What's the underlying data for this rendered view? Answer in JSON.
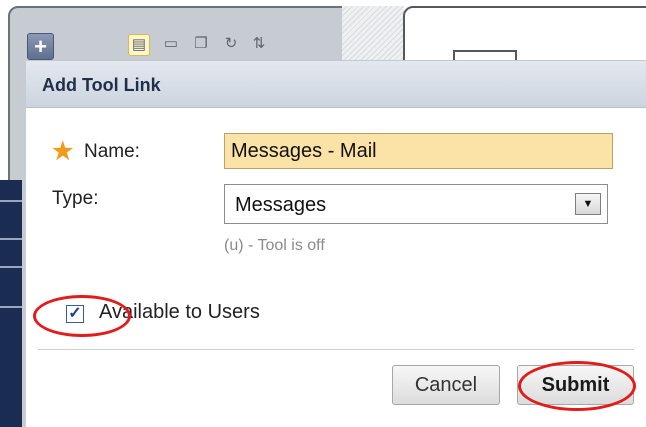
{
  "toolbar": {
    "add_icon": "plus-icon",
    "icons": [
      "list-icon",
      "folder-icon",
      "window-icon",
      "refresh-icon",
      "sort-icon"
    ],
    "add_label": "+"
  },
  "dialog": {
    "title": "Add Tool Link",
    "name_label": "Name:",
    "name_value": "Messages - Mail",
    "type_label": "Type:",
    "type_value": "Messages",
    "hint": "(u) - Tool is off",
    "available_label": "Available to Users",
    "available_checked": true,
    "cancel_label": "Cancel",
    "submit_label": "Submit"
  },
  "colors": {
    "required_star": "#f29a1a",
    "input_highlight": "#fbe3a8",
    "annotation_red": "#e21b1b"
  }
}
